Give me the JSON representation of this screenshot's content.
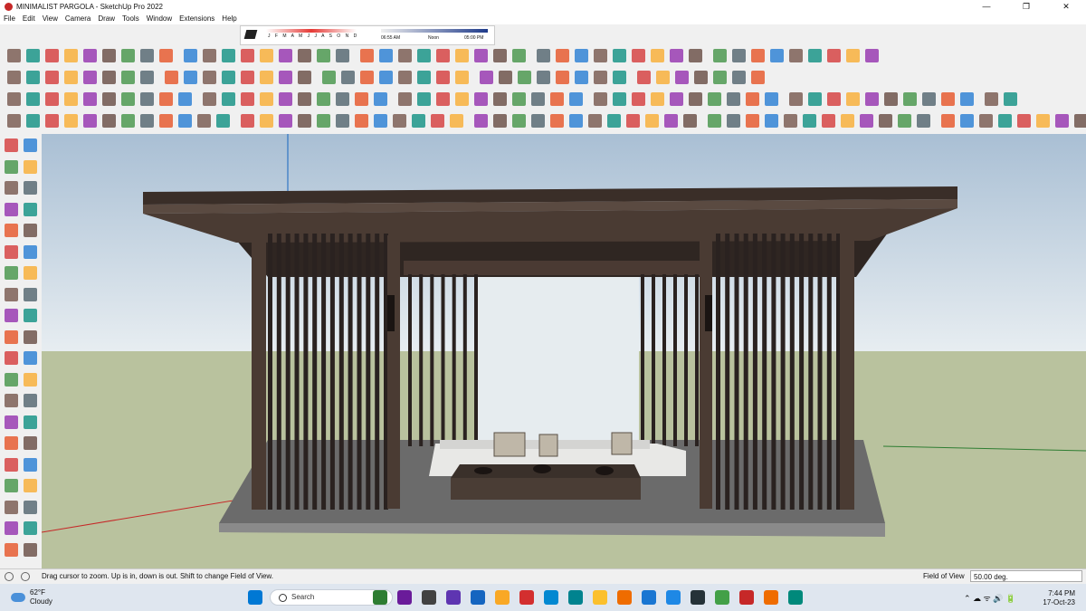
{
  "window": {
    "title": "MINIMALIST PARGOLA - SketchUp Pro 2022",
    "controls": [
      "—",
      "❐",
      "✕"
    ]
  },
  "menu": [
    "File",
    "Edit",
    "View",
    "Camera",
    "Draw",
    "Tools",
    "Window",
    "Extensions",
    "Help"
  ],
  "shadow_widget": {
    "months": "J F M A M J J A S O N D",
    "time_start": "06:55 AM",
    "time_noon": "Noon",
    "time_end": "05:00 PM"
  },
  "status": {
    "message": "Drag cursor to zoom.  Up is in, down is out. Shift to change Field of View.",
    "measurement_label": "Field of View",
    "measurement_value": "50.00 deg."
  },
  "taskbar": {
    "weather_temp": "62°F",
    "weather_desc": "Cloudy",
    "search_placeholder": "Search",
    "time": "7:44 PM",
    "date": "17-Oct-23",
    "tray": "⌃  ☁  ᯤ  🔊  🔋"
  },
  "colors": {
    "sky_top": "#a9bfd4",
    "sky_bottom": "#e7edf1",
    "ground": "#b9c29e",
    "wood_dark": "#3a2e28",
    "slat": "#2a2220",
    "floor": "#6b6b6b",
    "sofa": "#e8e8e6",
    "axis_red": "#c62828",
    "axis_green": "#2e7d32",
    "axis_blue": "#1565c0"
  }
}
